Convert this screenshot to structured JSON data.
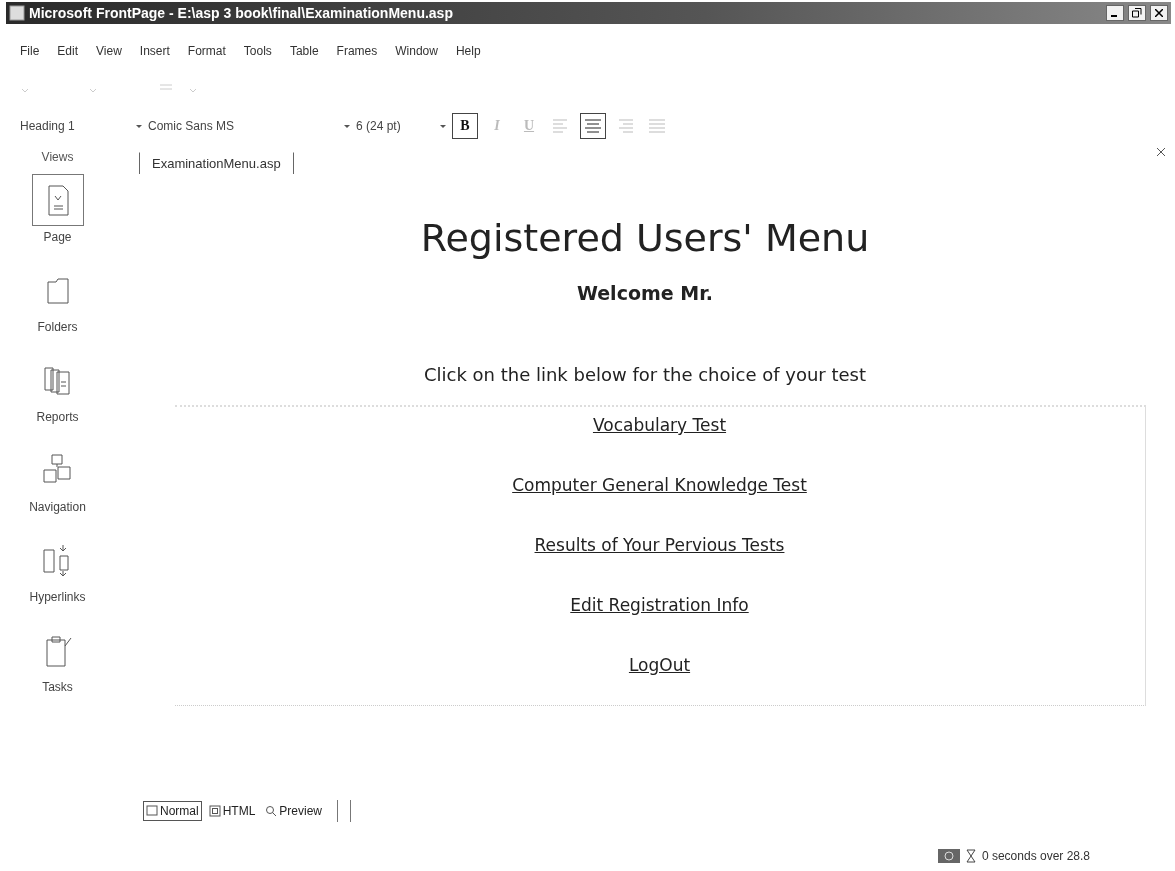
{
  "window": {
    "title": "Microsoft FrontPage - E:\\asp 3 book\\final\\ExaminationMenu.asp"
  },
  "menu": [
    "File",
    "Edit",
    "View",
    "Insert",
    "Format",
    "Tools",
    "Table",
    "Frames",
    "Window",
    "Help"
  ],
  "format_toolbar": {
    "style": "Heading 1",
    "font": "Comic Sans MS",
    "size": "6 (24 pt)",
    "buttons": [
      {
        "kind": "bold",
        "text": "B",
        "pressed": true
      },
      {
        "kind": "italic",
        "text": "I",
        "pressed": false
      },
      {
        "kind": "underline",
        "text": "U",
        "pressed": false
      },
      {
        "kind": "align-left",
        "pressed": false
      },
      {
        "kind": "align-center",
        "pressed": true
      },
      {
        "kind": "align-right",
        "pressed": false
      },
      {
        "kind": "justify",
        "pressed": false
      }
    ]
  },
  "views": {
    "label": "Views",
    "items": [
      {
        "kind": "page",
        "label": "Page",
        "selected": true
      },
      {
        "kind": "folders",
        "label": "Folders",
        "selected": false
      },
      {
        "kind": "reports",
        "label": "Reports",
        "selected": false
      },
      {
        "kind": "navigation",
        "label": "Navigation",
        "selected": false
      },
      {
        "kind": "hyperlinks",
        "label": "Hyperlinks",
        "selected": false
      },
      {
        "kind": "tasks",
        "label": "Tasks",
        "selected": false
      }
    ]
  },
  "document_tab": "ExaminationMenu.asp",
  "page": {
    "heading": "Registered Users' Menu",
    "welcome": "Welcome Mr.",
    "instruction": "Click on the link below for the choice of your test",
    "links": [
      "Vocabulary Test",
      "Computer General Knowledge Test",
      "Results of Your Pervious Tests",
      "Edit Registration Info",
      "LogOut"
    ]
  },
  "view_tabs": [
    {
      "kind": "normal",
      "label": "Normal",
      "selected": true
    },
    {
      "kind": "html",
      "label": "HTML",
      "selected": false
    },
    {
      "kind": "preview",
      "label": "Preview",
      "selected": false
    }
  ],
  "status_bar": {
    "download_time": "0 seconds over 28.8"
  }
}
